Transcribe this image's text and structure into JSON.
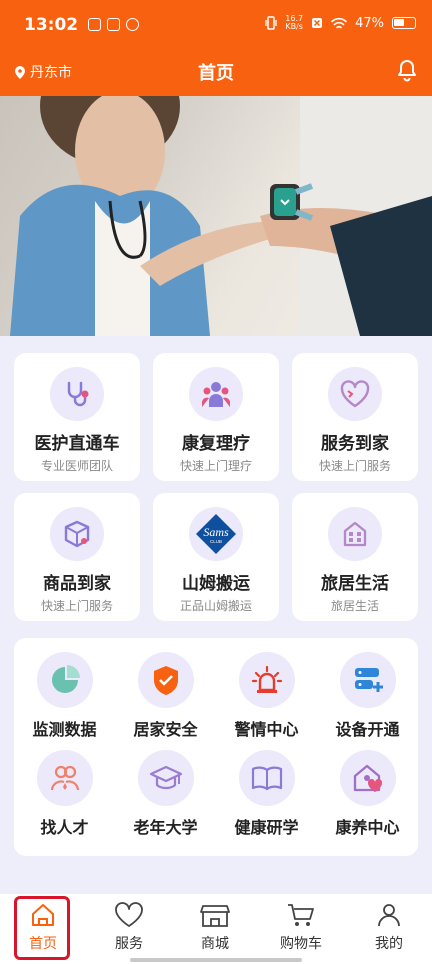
{
  "status_bar": {
    "time": "13:02",
    "net_speed_value": "16.7",
    "net_speed_unit": "KB/s",
    "battery": "47%"
  },
  "header": {
    "location": "丹东市",
    "title": "首页",
    "location_icon": "location-pin-icon",
    "bell_icon": "bell-icon"
  },
  "services": [
    {
      "title": "医护直通车",
      "subtitle": "专业医师团队",
      "icon": "stethoscope-icon"
    },
    {
      "title": "康复理疗",
      "subtitle": "快速上门理疗",
      "icon": "group-icon"
    },
    {
      "title": "服务到家",
      "subtitle": "快速上门服务",
      "icon": "heart-icon"
    },
    {
      "title": "商品到家",
      "subtitle": "快速上门服务",
      "icon": "package-icon"
    },
    {
      "title": "山姆搬运",
      "subtitle": "正品山姆搬运",
      "icon": "sams-club-logo",
      "logo_text": "Sams",
      "logo_sub": "CLUB"
    },
    {
      "title": "旅居生活",
      "subtitle": "旅居生活",
      "icon": "building-icon"
    }
  ],
  "quick_entries": [
    {
      "label": "监测数据",
      "icon": "pie-chart-icon"
    },
    {
      "label": "居家安全",
      "icon": "shield-icon"
    },
    {
      "label": "警情中心",
      "icon": "alarm-light-icon"
    },
    {
      "label": "设备开通",
      "icon": "server-add-icon"
    },
    {
      "label": "找人才",
      "icon": "people-search-icon"
    },
    {
      "label": "老年大学",
      "icon": "graduation-cap-icon"
    },
    {
      "label": "健康研学",
      "icon": "open-book-icon"
    },
    {
      "label": "康养中心",
      "icon": "house-heart-icon"
    }
  ],
  "tabbar": [
    {
      "label": "首页",
      "icon": "home-icon",
      "active": true
    },
    {
      "label": "服务",
      "icon": "heart-outline-icon",
      "active": false
    },
    {
      "label": "商城",
      "icon": "shop-icon",
      "active": false
    },
    {
      "label": "购物车",
      "icon": "cart-icon",
      "active": false
    },
    {
      "label": "我的",
      "icon": "user-icon",
      "active": false
    }
  ],
  "colors": {
    "brand": "#f8610f",
    "icon_bg": "#ebe9fa",
    "icon_purple": "#8a7ad8",
    "highlight": "#d9152c"
  }
}
